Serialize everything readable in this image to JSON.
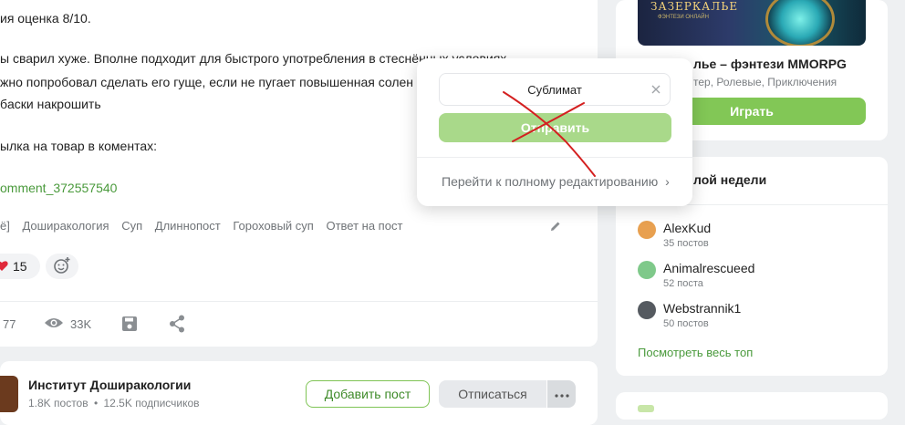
{
  "post": {
    "lines": [
      "ия оценка 8/10.",
      "ы сварил хуже. Вполне подходит для быстрого употребления в стеснённых условиях",
      "жно попробовал сделать его гуще, если не пугает повышенная солен",
      "бaски накрошить",
      "ылка на товар в коментах:"
    ],
    "link": "omment_372557540",
    "tags": [
      "ё]",
      "Доширакология",
      "Суп",
      "Длиннопост",
      "Гороховый суп",
      "Ответ на пост"
    ],
    "likes": "15",
    "comments": "77",
    "views": "33K"
  },
  "community": {
    "name": "Институт Доширакологии",
    "posts": "1.8K постов",
    "subscribers": "12.5K подписчиков",
    "add_post_label": "Добавить пост",
    "unsubscribe_label": "Отписаться"
  },
  "ad": {
    "banner_text": "ЗАЗЕРКАЛЬЕ",
    "banner_sub": "ФЭНТЕЗИ ОНЛАЙН",
    "title": "лье – фэнтези MMORPG",
    "genres": "тер, Ролевые, Приключения",
    "play_label": "Играть"
  },
  "top_week": {
    "title": "лой недели",
    "users": [
      {
        "name": "AlexKud",
        "posts": "35 постов",
        "color": "#e8a050"
      },
      {
        "name": "Animalrescueed",
        "posts": "52 поста",
        "color": "#7fc98a"
      },
      {
        "name": "Webstrannik1",
        "posts": "50 постов",
        "color": "#555a60"
      }
    ],
    "see_all": "Посмотреть весь топ"
  },
  "popup": {
    "input_value": "Сублимат",
    "submit_label": "Отправить",
    "full_edit_label": "Перейти к полному редактированию"
  },
  "colors": {
    "accent": "#82c756",
    "link": "#4a9a3c",
    "annotation": "#d42020"
  }
}
